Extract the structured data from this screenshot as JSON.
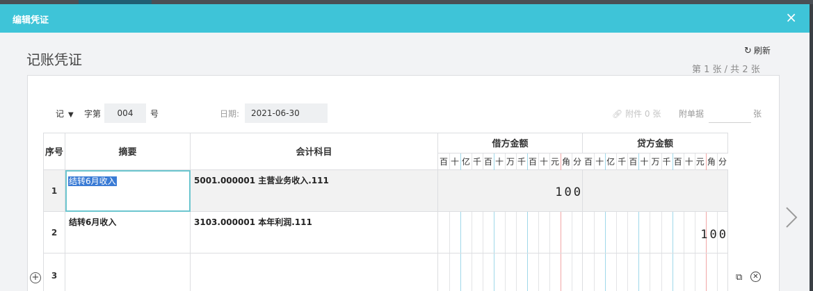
{
  "dialog": {
    "title": "编辑凭证",
    "close": "×"
  },
  "voucher": {
    "title": "记账凭证",
    "refresh_label": "刷新",
    "pager": "第 1 张 / 共 2 张",
    "word": "记",
    "zi_label": "字第",
    "number": "004",
    "hao_label": "号",
    "date_label": "日期:",
    "date": "2021-06-30",
    "attachment_label": "附件 0 张",
    "doc_count_label": "附单据",
    "doc_count_value": "",
    "zhang_label": "张"
  },
  "table": {
    "headers": {
      "seq": "序号",
      "summary": "摘要",
      "account": "会计科目",
      "debit": "借方金额",
      "credit": "贷方金额"
    },
    "digit_units": [
      "百",
      "十",
      "亿",
      "千",
      "百",
      "十",
      "万",
      "千",
      "百",
      "十",
      "元",
      "角",
      "分"
    ],
    "rows": [
      {
        "seq": "1",
        "summary": "结转6月收入",
        "account": "5001.000001 主营业务收入.111",
        "debit": "100",
        "credit": ""
      },
      {
        "seq": "2",
        "summary": "结转6月收入",
        "account": "3103.000001 本年利润.111",
        "debit": "",
        "credit": "100"
      },
      {
        "seq": "3",
        "summary": "",
        "account": "",
        "debit": "",
        "credit": ""
      }
    ]
  },
  "icons": {
    "refresh": "refresh-icon",
    "add_row": "plus-circle-icon",
    "copy": "copy-icon",
    "delete": "close-circle-icon",
    "next": "chevron-right-icon"
  },
  "colors": {
    "header_bar": "#3ec4d8",
    "selection": "#3a7bd5",
    "edit_border": "#6cc6cf",
    "guide_blue": "#9fd8ea",
    "guide_red": "#f2a6a6"
  }
}
